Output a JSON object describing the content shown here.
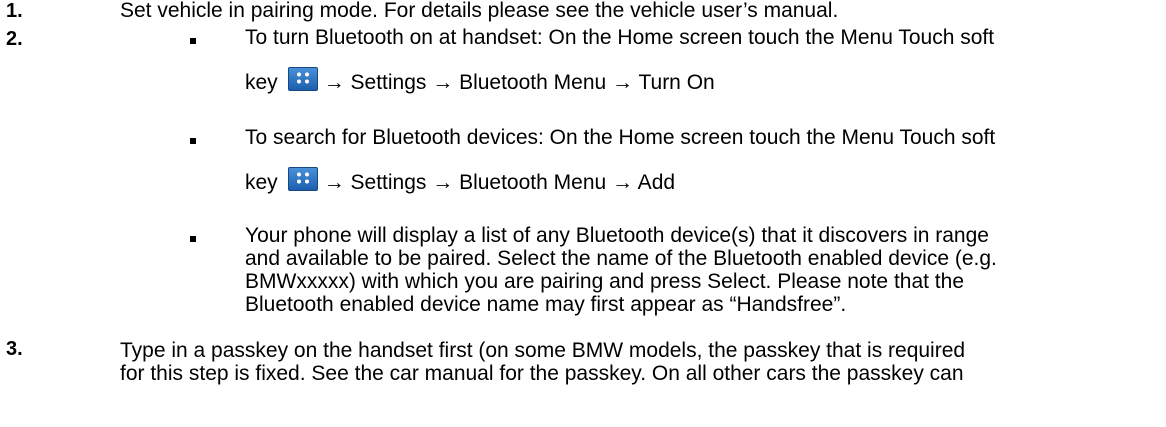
{
  "steps": [
    {
      "number": "1.",
      "text": "Set vehicle in pairing mode. For details please see the vehicle user’s manual."
    },
    {
      "number": "2.",
      "bullets": [
        {
          "line1": "To turn Bluetooth on at handset: On the Home screen touch the Menu Touch soft",
          "line2_prefix": "key",
          "line2_suffix": "→ Settings → Bluetooth Menu → Turn On",
          "icon": "menu-grid-icon"
        },
        {
          "line1": "To search for Bluetooth devices: On the Home screen touch the Menu Touch soft",
          "line2_prefix": "key",
          "line2_suffix": "→ Settings → Bluetooth Menu → Add",
          "icon": "menu-grid-icon"
        },
        {
          "lines": [
            "Your phone will display a list of any Bluetooth device(s) that it discovers in range",
            "and available to be paired. Select the name of the Bluetooth enabled device (e.g.",
            "BMWxxxxx) with which you are pairing and press Select. Please note that the",
            "Bluetooth enabled device name may first appear as “Handsfree”."
          ]
        }
      ]
    },
    {
      "number": "3.",
      "lines": [
        "Type in a passkey on the handset first (on some BMW models, the passkey that is required",
        "for this step is fixed. See the car manual for the passkey. On all other cars the passkey can"
      ]
    }
  ]
}
